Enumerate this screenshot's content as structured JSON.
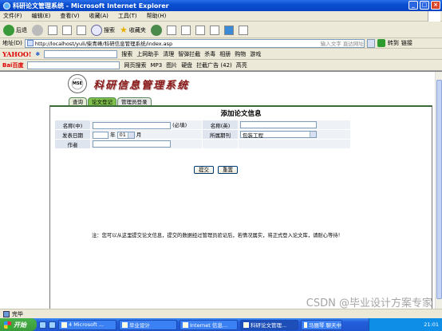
{
  "window": {
    "title": "科研论文管理系统 - Microsoft Internet Explorer"
  },
  "menu": [
    "文件(F)",
    "编辑(E)",
    "查看(V)",
    "收藏(A)",
    "工具(T)",
    "帮助(H)"
  ],
  "toolbar": {
    "back": "后退",
    "search": "搜索",
    "favorites": "收藏夹"
  },
  "address": {
    "label": "地址(D)",
    "url": "http://localhost/yuli/柴青峰/科研信息管理系统/index.asp",
    "search_hint": "输入文字 直达网址",
    "go": "转到",
    "links": "链接"
  },
  "yahoo_bar": {
    "brand": "YAHOO!",
    "search": "搜索",
    "items": [
      "上网助手",
      "清理",
      "智弹拦截",
      "杀毒",
      "相册",
      "购物",
      "游戏"
    ]
  },
  "baidu_bar": {
    "brand": "Bai百度",
    "items": [
      "网页搜索",
      "MP3",
      "图片",
      "硬盘",
      "拦截广告 (42)",
      "高亮"
    ]
  },
  "banner": {
    "logo_text": "MSE",
    "title": "科研信息管理系统"
  },
  "tabs": [
    "查询",
    "论文登记",
    "管理员登录"
  ],
  "form": {
    "title": "添加论文信息",
    "name_cn_label": "名称(中)",
    "required_hint": "(必填)",
    "name_en_label": "名称(英)",
    "date_label": "发表日期",
    "year_unit": "年",
    "month_value": "01",
    "month_unit": "月",
    "journal_label": "所属期刊",
    "journal_value": "包装工程",
    "author_label": "作者",
    "submit": "提交",
    "reset": "重置"
  },
  "note": "注：您可以从这里提交论文信息，提交的数据经过管理员验证后，若情况属实，将正式登入论文库，请耐心等待！",
  "status": {
    "text": "完毕"
  },
  "taskbar": {
    "start": "开始",
    "tasks": [
      "4 Microsoft ...",
      "毕业设计",
      "Internet 信息...",
      "科研论文管理...",
      "马丽琴 聊天中"
    ],
    "time": "21:01"
  },
  "watermark": "CSDN @毕业设计方案专家"
}
